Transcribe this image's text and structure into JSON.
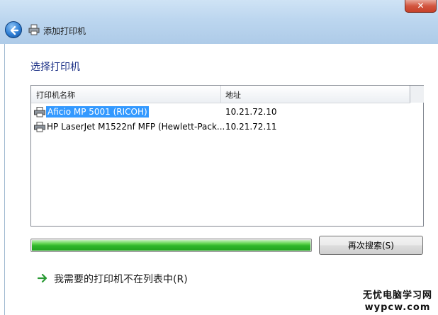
{
  "window": {
    "title": "添加打印机"
  },
  "page": {
    "heading": "选择打印机"
  },
  "printer_list": {
    "columns": [
      "打印机名称",
      "地址"
    ],
    "rows": [
      {
        "name": "Aficio MP 5001 (RICOH)",
        "address": "10.21.72.10",
        "selected": true
      },
      {
        "name": "HP LaserJet M1522nf MFP (Hewlett-Pack...",
        "address": "10.21.72.11",
        "selected": false
      }
    ]
  },
  "search": {
    "progress": 1.0,
    "button_label": "再次搜索(S)"
  },
  "not_listed_link": "我需要的打印机不在列表中(R)",
  "watermark": {
    "line1": "无忧电脑学习网",
    "line2": "wypcw.com"
  },
  "colors": {
    "selection": "#3399ff",
    "progress": "#2fb52a",
    "heading": "#1e3287"
  },
  "icons": [
    "back-arrow-icon",
    "printer-icon",
    "green-arrow-icon",
    "close-icon"
  ]
}
